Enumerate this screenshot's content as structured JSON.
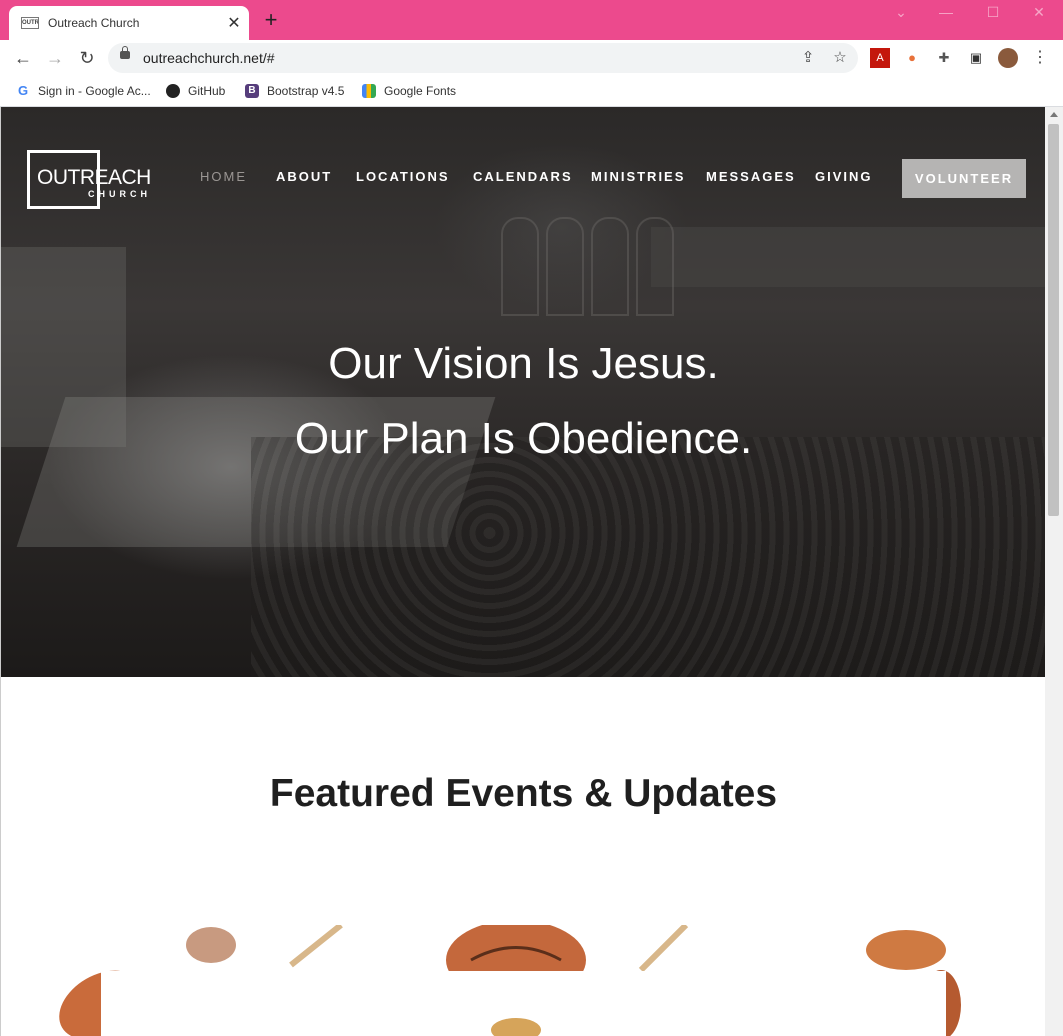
{
  "browser": {
    "tab_title": "Outreach Church",
    "tab_favicon": "outreach-favicon",
    "url": "outreachchurch.net/#",
    "bookmarks": [
      {
        "label": "Sign in - Google Ac...",
        "icon": "google-icon"
      },
      {
        "label": "GitHub",
        "icon": "github-icon"
      },
      {
        "label": "Bootstrap v4.5",
        "icon": "bootstrap-icon"
      },
      {
        "label": "Google Fonts",
        "icon": "google-fonts-icon"
      }
    ],
    "titlebar_color": "#ec4a8d"
  },
  "site": {
    "logo": {
      "line1": "OUTREACH",
      "line2": "CHURCH"
    },
    "nav": [
      {
        "label": "HOME",
        "active": true
      },
      {
        "label": "ABOUT"
      },
      {
        "label": "LOCATIONS"
      },
      {
        "label": "CALENDARS"
      },
      {
        "label": "MINISTRIES"
      },
      {
        "label": "MESSAGES"
      },
      {
        "label": "GIVING"
      }
    ],
    "cta": "VOLUNTEER",
    "hero": {
      "line1": "Our Vision Is Jesus.",
      "line2": "Our Plan Is Obedience."
    },
    "featured_title": "Featured Events & Updates"
  }
}
